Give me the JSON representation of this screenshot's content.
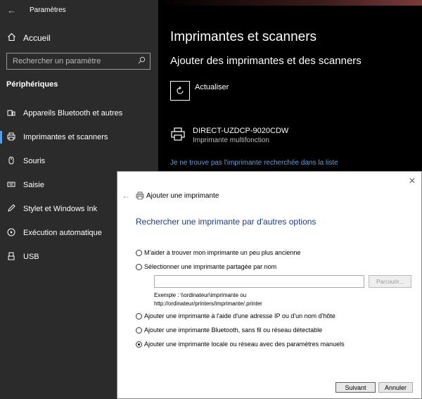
{
  "window": {
    "title": "Paramètres"
  },
  "sidebar": {
    "home_label": "Accueil",
    "search_placeholder": "Rechercher un paramètre",
    "section_title": "Périphériques",
    "items": [
      {
        "label": "Appareils Bluetooth et autres",
        "icon": "bluetooth-devices-icon"
      },
      {
        "label": "Imprimantes et scanners",
        "icon": "printer-icon",
        "active": true
      },
      {
        "label": "Souris",
        "icon": "mouse-icon"
      },
      {
        "label": "Saisie",
        "icon": "keyboard-icon"
      },
      {
        "label": "Stylet et Windows Ink",
        "icon": "pen-icon"
      },
      {
        "label": "Exécution automatique",
        "icon": "autoplay-icon"
      },
      {
        "label": "USB",
        "icon": "usb-icon"
      }
    ]
  },
  "main": {
    "title": "Imprimantes et scanners",
    "subtitle": "Ajouter des imprimantes et des scanners",
    "refresh_label": "Actualiser",
    "printer": {
      "name": "DIRECT-UZDCP-9020CDW",
      "type": "Imprimante multifonction"
    },
    "missing_link": "Je ne trouve pas l'imprimante recherchée dans la liste"
  },
  "dialog": {
    "title": "Ajouter une imprimante",
    "heading": "Rechercher une imprimante par d'autres options",
    "options": [
      {
        "label": "M'aider à trouver mon imprimante un peu plus ancienne",
        "checked": false
      },
      {
        "label": "Sélectionner une imprimante partagée par nom",
        "checked": false
      },
      {
        "label": "Ajouter une imprimante à l'aide d'une adresse IP ou d'un nom d'hôte",
        "checked": false
      },
      {
        "label": "Ajouter une imprimante Bluetooth, sans fil ou réseau détectable",
        "checked": false
      },
      {
        "label": "Ajouter une imprimante locale ou réseau avec des paramètres manuels",
        "checked": true
      }
    ],
    "share_input_value": "",
    "browse_label": "Parcourir...",
    "example_line1": "Exemple : \\\\ordinateur\\imprimante ou",
    "example_line2": "http://ordinateur/printers/imprimante/.printer",
    "next_label": "Suivant",
    "cancel_label": "Annuler"
  },
  "colors": {
    "accent": "#5aa0e6",
    "sidebar_bg": "#2b2b2b",
    "dialog_heading": "#1a3d8a"
  }
}
